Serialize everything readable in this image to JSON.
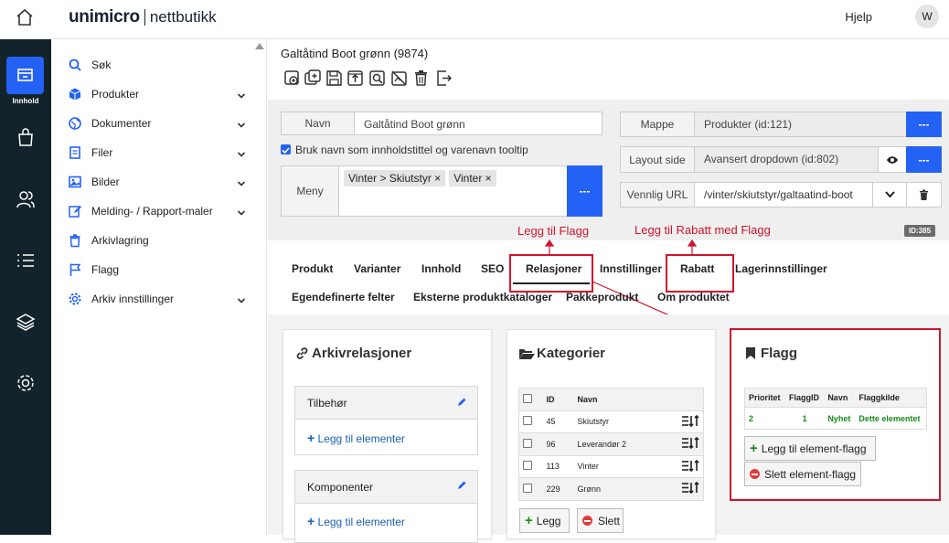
{
  "brand": {
    "name": "unimicro",
    "suffix": "nettbutikk"
  },
  "header": {
    "help": "Hjelp",
    "avatar": "W"
  },
  "rail": {
    "active_label": "Innhold"
  },
  "menu": [
    {
      "label": "Søk",
      "icon": "search-icon",
      "chevron": false
    },
    {
      "label": "Produkter",
      "icon": "cube-icon",
      "chevron": true
    },
    {
      "label": "Dokumenter",
      "icon": "globe-icon",
      "chevron": true
    },
    {
      "label": "Filer",
      "icon": "file-icon",
      "chevron": true
    },
    {
      "label": "Bilder",
      "icon": "image-icon",
      "chevron": true
    },
    {
      "label": "Melding- / Rapport-maler",
      "icon": "edit-icon",
      "chevron": true
    },
    {
      "label": "Arkivlagring",
      "icon": "trash-icon",
      "chevron": false
    },
    {
      "label": "Flagg",
      "icon": "flag-icon",
      "chevron": false
    },
    {
      "label": "Arkiv innstillinger",
      "icon": "gear-icon",
      "chevron": true
    }
  ],
  "page": {
    "title": "Galtåtind Boot grønn (9874)"
  },
  "form": {
    "navn_label": "Navn",
    "navn_value": "Galtåtind Boot grønn",
    "checkbox_label": "Bruk navn som innholdstittel og varenavn tooltip",
    "checkbox_checked": true,
    "meny_label": "Meny",
    "meny_chips": [
      "Vinter > Skiutstyr",
      "Vinter"
    ],
    "mappe_label": "Mappe",
    "mappe_value": "Produkter (id:121)",
    "layout_label": "Layout side",
    "layout_value": "Avansert dropdown (id:802)",
    "url_label": "Vennlig URL",
    "url_value": "/vinter/skiutstyr/galtaatind-boot",
    "dots": "---",
    "id_badge": "ID:385"
  },
  "annotations": {
    "flag": "Legg til Flagg",
    "rabatt": "Legg til Rabatt med Flagg"
  },
  "tabs_row1": [
    "Produkt",
    "Varianter",
    "Innhold",
    "SEO",
    "Relasjoner",
    "Innstillinger",
    "Rabatt",
    "Lagerinnstillinger"
  ],
  "tabs_row2": [
    "Egendefinerte felter",
    "Eksterne produktkataloger",
    "Pakkeprodukt",
    "Om produktet"
  ],
  "arkiv": {
    "title": "Arkivrelasjoner",
    "cards": [
      {
        "title": "Tilbehør",
        "add": "Legg til elementer"
      },
      {
        "title": "Komponenter",
        "add": "Legg til elementer"
      }
    ]
  },
  "kategorier": {
    "title": "Kategorier",
    "headers": [
      "ID",
      "Navn"
    ],
    "rows": [
      {
        "id": "45",
        "name": "Skiutstyr"
      },
      {
        "id": "96",
        "name": "Leverandør 2"
      },
      {
        "id": "113",
        "name": "Vinter"
      },
      {
        "id": "229",
        "name": "Grønn"
      }
    ],
    "add": "Legg",
    "delete": "Slett"
  },
  "flagg": {
    "title": "Flagg",
    "headers": [
      "Prioritet",
      "FlaggID",
      "Navn",
      "Flaggkilde"
    ],
    "rows": [
      {
        "prioritet": "2",
        "id": "1",
        "navn": "Nyhet",
        "kilde": "Dette elementet"
      }
    ],
    "add": "Legg til element-flagg",
    "delete": "Slett element-flagg"
  },
  "colors": {
    "accent": "#2462f5",
    "rail": "#12232b",
    "annotation": "#d0142d",
    "green": "#1a8a1a"
  }
}
